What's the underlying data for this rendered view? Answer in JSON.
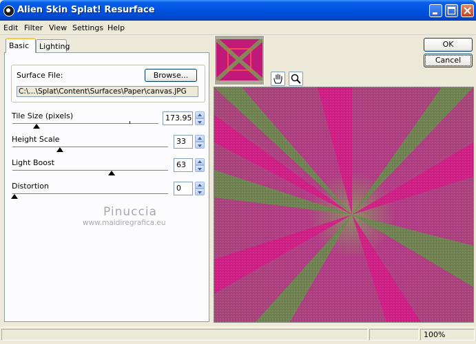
{
  "window": {
    "title": "Alien Skin Splat! Resurface"
  },
  "menu": [
    "Edit",
    "Filter",
    "View",
    "Settings",
    "Help"
  ],
  "tabs": [
    "Basic",
    "Lighting"
  ],
  "surface": {
    "label": "Surface File:",
    "browse_label": "Browse...",
    "path": "C:\\...\\Splat\\Content\\Surfaces\\Paper\\canvas.JPG"
  },
  "params": {
    "tile_size": {
      "label": "Tile Size (pixels)",
      "value": "173.95"
    },
    "height_scale": {
      "label": "Height Scale",
      "value": "33"
    },
    "light_boost": {
      "label": "Light Boost",
      "value": "63"
    },
    "distortion": {
      "label": "Distortion",
      "value": "0"
    }
  },
  "watermark": {
    "name": "Pinuccia",
    "url": "www.maidiregrafica.eu"
  },
  "buttons": {
    "ok": "OK",
    "cancel": "Cancel"
  },
  "statusbar": {
    "zoom": "100%"
  },
  "colors": {
    "magenta": "#c0197a",
    "green": "#6b8a4f",
    "title_blue": "#0054e3"
  },
  "icons": {
    "hand_tool": "hand-icon",
    "zoom_tool": "magnifier-icon"
  }
}
